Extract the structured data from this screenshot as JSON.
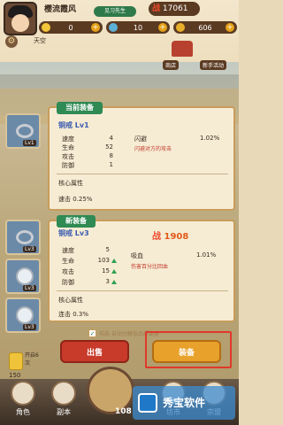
{
  "player": {
    "name": "樱流霞风",
    "level_tag": "见习先生",
    "power_label": "战",
    "power_value": "17061"
  },
  "resources": [
    {
      "icon": "gold-coin-icon",
      "color": "#f3c53a",
      "value": "0"
    },
    {
      "icon": "tea-cup-icon",
      "color": "#5bb1d8",
      "value": "10"
    },
    {
      "icon": "ingot-icon",
      "color": "#e8b02a",
      "value": "606"
    }
  ],
  "scene": {
    "cloud_name": "天空"
  },
  "top_right": {
    "shop_label": "商店",
    "event_label": "新手活动"
  },
  "current_panel": {
    "title": "当前装备",
    "equip_name": "铜戒 Lv1",
    "slot_level": "Lv1",
    "stats": [
      {
        "label": "速度",
        "value": "4"
      },
      {
        "label": "生命",
        "value": "52"
      },
      {
        "label": "攻击",
        "value": "8"
      },
      {
        "label": "防御",
        "value": "1"
      }
    ],
    "skill": {
      "name": "闪避",
      "value": "1.02%",
      "desc": "闪避对方的攻击"
    },
    "core_label": "核心属性",
    "core_value": "速击 0.25%"
  },
  "new_panel": {
    "title": "新装备",
    "equip_name": "铜戒 Lv3",
    "power_label": "战",
    "power_value": "1908",
    "slot_levels": [
      "Lv3",
      "Lv3",
      "Lv3"
    ],
    "stats": [
      {
        "label": "速度",
        "value": "5"
      },
      {
        "label": "生命",
        "value": "103"
      },
      {
        "label": "攻击",
        "value": "15"
      },
      {
        "label": "防御",
        "value": "3"
      }
    ],
    "skill": {
      "name": "吸血",
      "value": "1.01%",
      "desc": "伤害百分比回血"
    },
    "core_label": "核心属性",
    "core_value": "连击 0.3%"
  },
  "checkbox_label": "勾选 自动分解低品质装备",
  "buttons": {
    "sell": "出售",
    "equip": "装备"
  },
  "side_gold": {
    "label": "开启6次",
    "value": "150"
  },
  "bottom_nav": [
    {
      "label": "角色",
      "icon": "character-icon"
    },
    {
      "label": "副本",
      "icon": "dungeon-icon"
    },
    {
      "label": "坊市",
      "icon": "market-icon"
    },
    {
      "label": "宗盟",
      "icon": "sect-icon"
    }
  ],
  "center_count": "108",
  "watermark": "秀宝软件"
}
